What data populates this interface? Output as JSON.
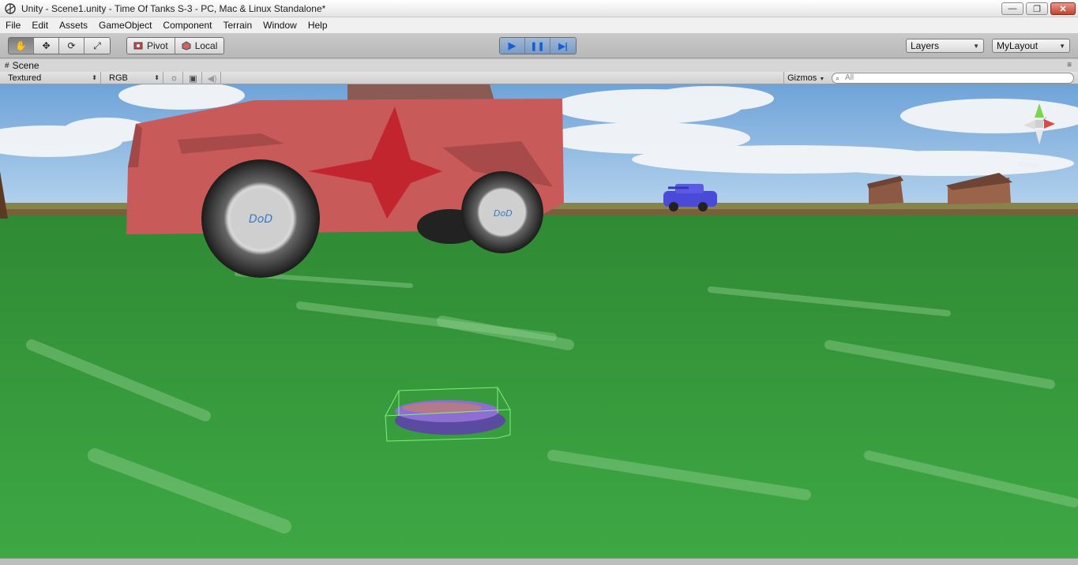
{
  "window": {
    "title": "Unity - Scene1.unity - Time Of Tanks S-3 - PC, Mac & Linux Standalone*",
    "min_glyph": "—",
    "max_glyph": "❐",
    "close_glyph": "✕"
  },
  "menu": [
    "File",
    "Edit",
    "Assets",
    "GameObject",
    "Component",
    "Terrain",
    "Window",
    "Help"
  ],
  "toolbar": {
    "tools": [
      {
        "name": "hand-tool",
        "glyph": "✋"
      },
      {
        "name": "move-tool",
        "glyph": "✥"
      },
      {
        "name": "rotate-tool",
        "glyph": "⟳"
      },
      {
        "name": "scale-tool",
        "glyph": "⤢"
      }
    ],
    "pivot_label": "Pivot",
    "local_label": "Local",
    "play_glyph": "▶",
    "pause_glyph": "❚❚",
    "step_glyph": "▶|",
    "layers_label": "Layers",
    "layout_label": "MyLayout"
  },
  "scene": {
    "tab_label": "Scene",
    "render_mode": "Textured",
    "color_mode": "RGB",
    "gizmos_label": "Gizmos",
    "search_placeholder": "All",
    "view_label": "Persp"
  },
  "colors": {
    "sky": "#9fc4e6",
    "grass": "#3a9a3e",
    "car_body": "#c85a5a",
    "enemy_tank": "#4a4ad8",
    "selection": "#7cf07c"
  }
}
